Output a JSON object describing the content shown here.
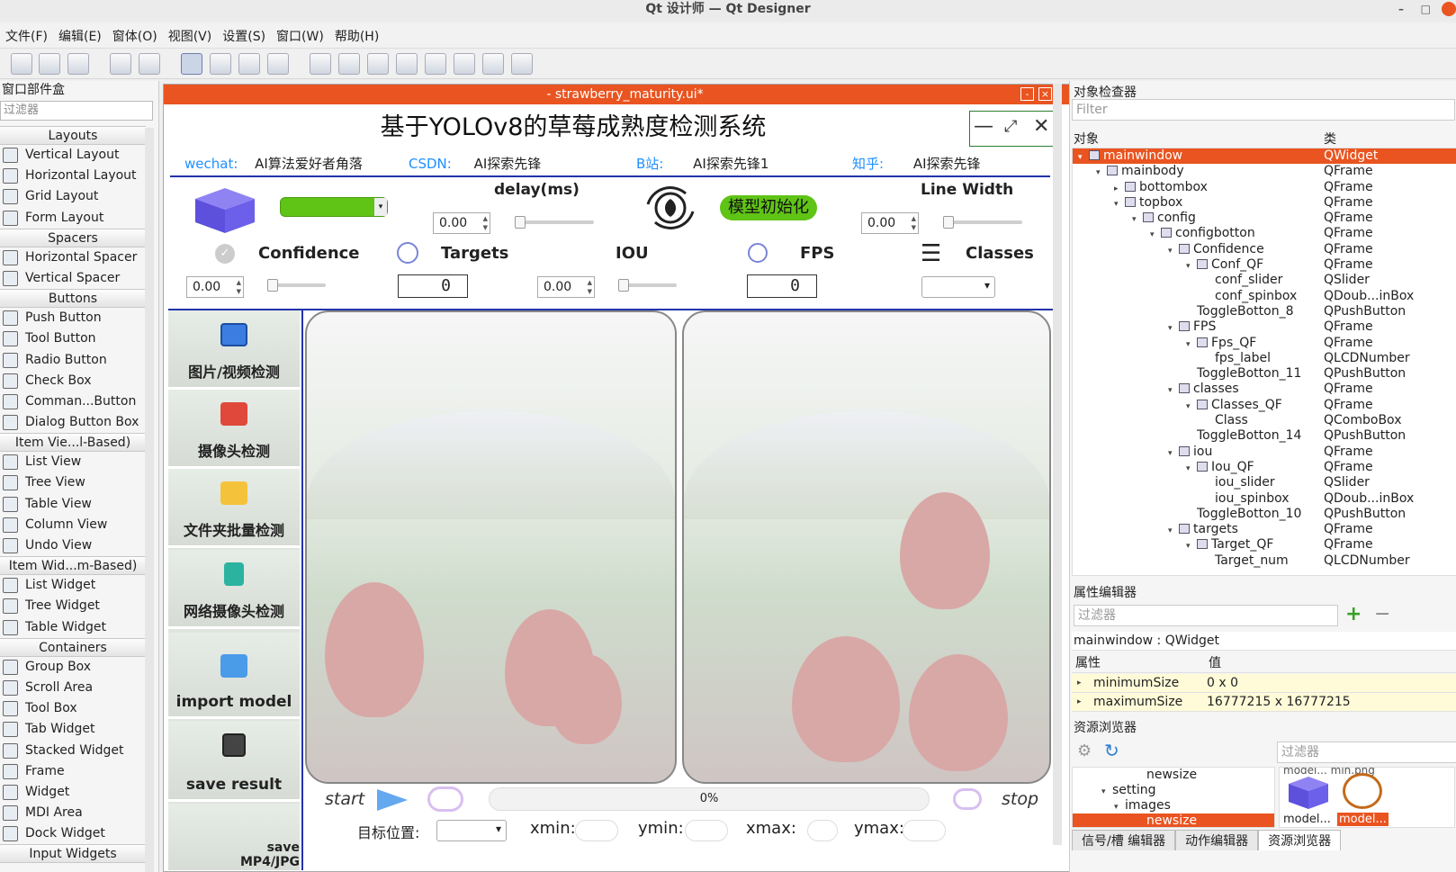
{
  "window": {
    "title": "Qt 设计师 — Qt Designer"
  },
  "menu": [
    "文件(F)",
    "编辑(E)",
    "窗体(O)",
    "视图(V)",
    "设置(S)",
    "窗口(W)",
    "帮助(H)"
  ],
  "widget_box": {
    "title": "窗口部件盒",
    "filter_placeholder": "过滤器",
    "groups": [
      {
        "category": "Layouts",
        "items": [
          "Vertical Layout",
          "Horizontal Layout",
          "Grid Layout",
          "Form Layout"
        ]
      },
      {
        "category": "Spacers",
        "items": [
          "Horizontal Spacer",
          "Vertical Spacer"
        ]
      },
      {
        "category": "Buttons",
        "items": [
          "Push Button",
          "Tool Button",
          "Radio Button",
          "Check Box",
          "Comman...Button",
          "Dialog Button Box"
        ]
      },
      {
        "category": "Item Vie...l-Based)",
        "items": [
          "List View",
          "Tree View",
          "Table View",
          "Column View",
          "Undo View"
        ]
      },
      {
        "category": "Item Wid...m-Based)",
        "items": [
          "List Widget",
          "Tree Widget",
          "Table Widget"
        ]
      },
      {
        "category": "Containers",
        "items": [
          "Group Box",
          "Scroll Area",
          "Tool Box",
          "Tab Widget",
          "Stacked Widget",
          "Frame",
          "Widget",
          "MDI Area",
          "Dock Widget"
        ]
      },
      {
        "category": "Input Widgets",
        "items": []
      }
    ]
  },
  "form_window": {
    "title": "- strawberry_maturity.ui*",
    "app_title": "基于YOLOv8的草莓成熟度检测系统",
    "info": [
      {
        "key": "wechat:",
        "value": "AI算法爱好者角落"
      },
      {
        "key": "CSDN:",
        "value": "AI探索先锋"
      },
      {
        "key": "B站:",
        "value": "AI探索先锋1"
      },
      {
        "key": "知乎:",
        "value": "AI探索先锋"
      }
    ],
    "delay_label": "delay(ms)",
    "delay_value": "0.00",
    "init_button": "模型初始化",
    "line_width_label": "Line Width",
    "line_width_value": "0.00",
    "confidence_label": "Confidence",
    "confidence_value": "0.00",
    "targets_label": "Targets",
    "targets_value": "0",
    "iou_label": "IOU",
    "iou_value": "0.00",
    "fps_label": "FPS",
    "fps_value": "0",
    "classes_label": "Classes",
    "side_buttons": [
      "图片/视频检测",
      "摄像头检测",
      "文件夹批量检测",
      "网络摄像头检测",
      "import model",
      "save result",
      "save MP4/JPG"
    ],
    "start_label": "start",
    "stop_label": "stop",
    "progress_text": "0%",
    "progress": 0,
    "target_pos_label": "目标位置:",
    "coords": [
      "xmin:",
      "ymin:",
      "xmax:",
      "ymax:"
    ]
  },
  "object_inspector": {
    "title": "对象检查器",
    "filter_placeholder": "Filter",
    "col_object": "对象",
    "col_class": "类",
    "rows": [
      {
        "name": "mainwindow",
        "cls": "QWidget",
        "depth": 0,
        "exp": "▾",
        "sel": true,
        "icon": true
      },
      {
        "name": "mainbody",
        "cls": "QFrame",
        "depth": 1,
        "exp": "▾",
        "icon": true
      },
      {
        "name": "bottombox",
        "cls": "QFrame",
        "depth": 2,
        "exp": "▸",
        "icon": true
      },
      {
        "name": "topbox",
        "cls": "QFrame",
        "depth": 2,
        "exp": "▾",
        "icon": true
      },
      {
        "name": "config",
        "cls": "QFrame",
        "depth": 3,
        "exp": "▾",
        "icon": true
      },
      {
        "name": "configbotton",
        "cls": "QFrame",
        "depth": 4,
        "exp": "▾",
        "icon": true
      },
      {
        "name": "Confidence",
        "cls": "QFrame",
        "depth": 5,
        "exp": "▾",
        "icon": true
      },
      {
        "name": "Conf_QF",
        "cls": "QFrame",
        "depth": 6,
        "exp": "▾",
        "icon": true
      },
      {
        "name": "conf_slider",
        "cls": "QSlider",
        "depth": 7,
        "exp": ""
      },
      {
        "name": "conf_spinbox",
        "cls": "QDoub...inBox",
        "depth": 7,
        "exp": ""
      },
      {
        "name": "ToggleBotton_8",
        "cls": "QPushButton",
        "depth": 6,
        "exp": ""
      },
      {
        "name": "FPS",
        "cls": "QFrame",
        "depth": 5,
        "exp": "▾",
        "icon": true
      },
      {
        "name": "Fps_QF",
        "cls": "QFrame",
        "depth": 6,
        "exp": "▾",
        "icon": true
      },
      {
        "name": "fps_label",
        "cls": "QLCDNumber",
        "depth": 7,
        "exp": ""
      },
      {
        "name": "ToggleBotton_11",
        "cls": "QPushButton",
        "depth": 6,
        "exp": ""
      },
      {
        "name": "classes",
        "cls": "QFrame",
        "depth": 5,
        "exp": "▾",
        "icon": true
      },
      {
        "name": "Classes_QF",
        "cls": "QFrame",
        "depth": 6,
        "exp": "▾",
        "icon": true
      },
      {
        "name": "Class",
        "cls": "QComboBox",
        "depth": 7,
        "exp": ""
      },
      {
        "name": "ToggleBotton_14",
        "cls": "QPushButton",
        "depth": 6,
        "exp": ""
      },
      {
        "name": "iou",
        "cls": "QFrame",
        "depth": 5,
        "exp": "▾",
        "icon": true
      },
      {
        "name": "Iou_QF",
        "cls": "QFrame",
        "depth": 6,
        "exp": "▾",
        "icon": true
      },
      {
        "name": "iou_slider",
        "cls": "QSlider",
        "depth": 7,
        "exp": ""
      },
      {
        "name": "iou_spinbox",
        "cls": "QDoub...inBox",
        "depth": 7,
        "exp": ""
      },
      {
        "name": "ToggleBotton_10",
        "cls": "QPushButton",
        "depth": 6,
        "exp": ""
      },
      {
        "name": "targets",
        "cls": "QFrame",
        "depth": 5,
        "exp": "▾",
        "icon": true
      },
      {
        "name": "Target_QF",
        "cls": "QFrame",
        "depth": 6,
        "exp": "▾",
        "icon": true
      },
      {
        "name": "Target_num",
        "cls": "QLCDNumber",
        "depth": 7,
        "exp": ""
      }
    ]
  },
  "property_editor": {
    "title": "属性编辑器",
    "filter_placeholder": "过滤器",
    "object_line": "mainwindow : QWidget",
    "col_prop": "属性",
    "col_value": "值",
    "rows": [
      {
        "name": "minimumSize",
        "value": "0 x 0"
      },
      {
        "name": "maximumSize",
        "value": "16777215 x 16777215"
      }
    ]
  },
  "resource_browser": {
    "title": "资源浏览器",
    "filter_placeholder": "过滤器",
    "tree": [
      "newsize",
      "setting",
      "images",
      "newsize"
    ],
    "thumbs": [
      "model...",
      "model..."
    ],
    "thumb_top": "model... min.png"
  },
  "bottom_tabs": [
    "信号/槽 编辑器",
    "动作编辑器",
    "资源浏览器"
  ],
  "colors": {
    "accent": "#e95420",
    "progress_green": "#5fc416",
    "title_blue": "#1e90ff"
  }
}
